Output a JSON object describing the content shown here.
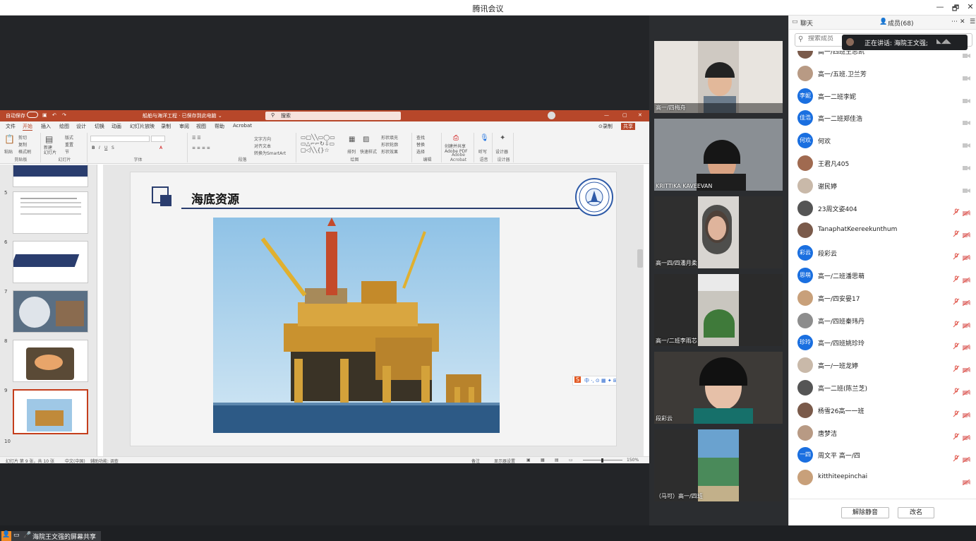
{
  "window": {
    "title": "腾讯会议",
    "controls": [
      "—",
      "🗗",
      "✕"
    ]
  },
  "ppt": {
    "autosave_label": "自动保存",
    "doc_title": "船舶与海洋工程 · 已保存到此电脑 ⌄",
    "search_placeholder": "搜索",
    "menu": [
      "文件",
      "开始",
      "插入",
      "绘图",
      "设计",
      "切换",
      "动画",
      "幻灯片放映",
      "录制",
      "审阅",
      "视图",
      "帮助",
      "Acrobat"
    ],
    "record_label": "⊙录制",
    "share_label": "共享",
    "ribbon_groups": [
      "剪贴板",
      "幻灯片",
      "字体",
      "段落",
      "绘图",
      "编辑",
      "Adobe Acrobat",
      "语音",
      "设计器"
    ],
    "ribbon_items": {
      "paste": "粘贴",
      "cut": "剪切",
      "copy": "复制",
      "format_painter": "格式刷",
      "new_slide": "新建\n幻灯片",
      "layout": "版式",
      "reset": "重置",
      "section": "节",
      "text_direction": "文字方向",
      "align_text": "对齐文本",
      "smartart": "转换为SmartArt",
      "arrange": "排列",
      "quick_styles": "快速样式",
      "shape_fill": "形状填充",
      "shape_outline": "形状轮廓",
      "shape_effects": "形状效果",
      "find": "查找",
      "replace": "替换",
      "select": "选择",
      "create_pdf": "创建并共享\nAdobe PDF",
      "dictate": "听写",
      "designer": "设计器"
    },
    "thumb_numbers": [
      "5",
      "6",
      "7",
      "8",
      "9",
      "10"
    ],
    "slide": {
      "title": "海底资源"
    },
    "status": {
      "slide_count": "幻灯片 第 9 张，共 10 张",
      "language": "中文(中国)",
      "accessibility": "辅助功能: 调查",
      "notes": "备注",
      "display_settings": "显示器设置",
      "zoom": "150%"
    }
  },
  "share_label": "海院王文强的屏幕共享",
  "ime_label": "中 ·, ⊙ ▦ ✦ ⊞",
  "videos": [
    {
      "name": "高一/四梅舟"
    },
    {
      "name": "KRITTIKA KAVEEVAN"
    },
    {
      "name": "高一四/四潘月柔"
    },
    {
      "name": "高一/二班李雨芯"
    },
    {
      "name": "段彩云"
    },
    {
      "name": "（马可）高一/四班"
    }
  ],
  "panel": {
    "tab_chat": "聊天",
    "tab_members": "成员(68)",
    "search_placeholder": "搜索成员",
    "speaking": "正在讲话: 海院王文强;",
    "members": [
      {
        "name": "高一/四班王思凯",
        "avatar": ""
      },
      {
        "name": "高一/五班.卫兰芳",
        "avatar": ""
      },
      {
        "name": "高一二班李妮",
        "avatar": "李妮"
      },
      {
        "name": "高一二班郑佳浩",
        "avatar": "佳浩"
      },
      {
        "name": "何欢",
        "avatar": "何欢"
      },
      {
        "name": "王君凡405",
        "avatar": ""
      },
      {
        "name": "谢民婷",
        "avatar": ""
      },
      {
        "name": "23周文姿404",
        "avatar": ""
      },
      {
        "name": "TanaphatKeereekunthum",
        "avatar": ""
      },
      {
        "name": "段彩云",
        "avatar": "彩云"
      },
      {
        "name": "高一/二班潘思萌",
        "avatar": "思萌"
      },
      {
        "name": "高一/四安晏17",
        "avatar": ""
      },
      {
        "name": "高一/四班秦玮丹",
        "avatar": ""
      },
      {
        "name": "高一/四班姚珍玲",
        "avatar": "珍玲"
      },
      {
        "name": "高一/一班龙婷",
        "avatar": ""
      },
      {
        "name": "高一二班(陈兰芝)",
        "avatar": ""
      },
      {
        "name": "杨雪26高一一班",
        "avatar": ""
      },
      {
        "name": "唐梦洁",
        "avatar": ""
      },
      {
        "name": "周文平 高一/四",
        "avatar": "一四"
      },
      {
        "name": "kitthiteepinchai",
        "avatar": ""
      }
    ],
    "unmute_all": "解除静音",
    "rename": "改名"
  },
  "colors": {
    "ppt_accent": "#b7472a",
    "meeting_blue": "#1a6fe0",
    "mic_muted": "#e0554a"
  }
}
